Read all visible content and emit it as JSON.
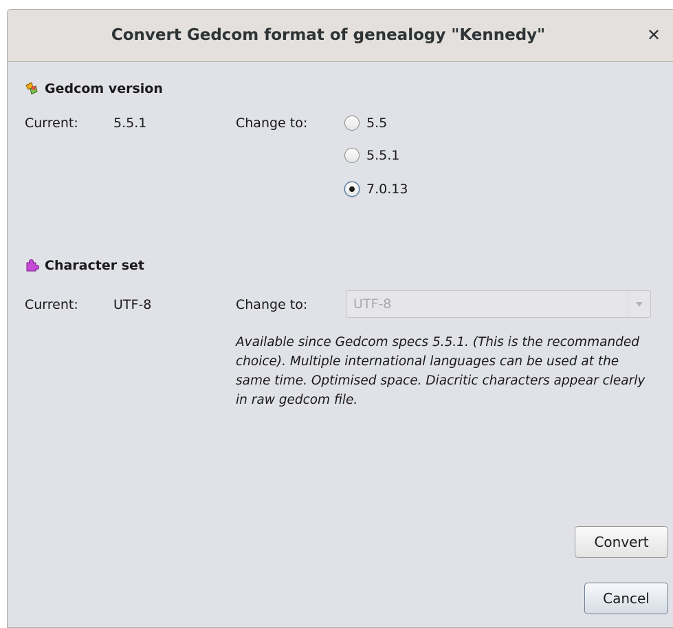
{
  "dialog": {
    "title": "Convert Gedcom format of genealogy \"Kennedy\"",
    "close_glyph": "✕"
  },
  "gedcom_version": {
    "header": "Gedcom version",
    "icon": "gedcom-version-icon",
    "current_label": "Current:",
    "current_value": "5.5.1",
    "change_label": "Change to:",
    "options": [
      {
        "label": "5.5",
        "checked": false
      },
      {
        "label": "5.5.1",
        "checked": false
      },
      {
        "label": "7.0.13",
        "checked": true
      }
    ]
  },
  "character_set": {
    "header": "Character set",
    "icon": "puzzle-piece-icon",
    "current_label": "Current:",
    "current_value": "UTF-8",
    "change_label": "Change to:",
    "selected": "UTF-8",
    "enabled": false,
    "description": "Available since Gedcom specs 5.5.1. (This is the recommanded choice). Multiple international languages can be used at the same time. Optimised space. Diacritic characters appear clearly in raw gedcom file."
  },
  "buttons": {
    "convert": "Convert",
    "cancel": "Cancel"
  },
  "colors": {
    "window_bg": "#e1e2e7",
    "titlebar_bg": "#e3e0dd",
    "icon_puzzle": "#c84bd8"
  }
}
